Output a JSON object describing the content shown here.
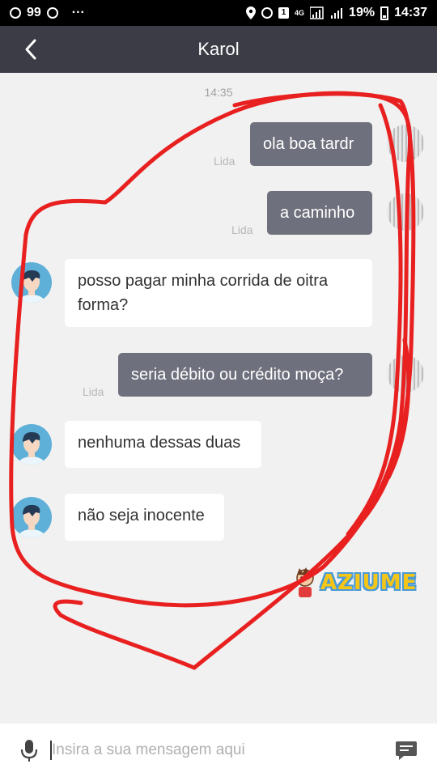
{
  "status_bar": {
    "left_count": "99",
    "dots": "···",
    "network": "4G",
    "battery": "19%",
    "time": "14:37"
  },
  "header": {
    "title": "Karol"
  },
  "chat": {
    "timestamp": "14:35",
    "messages": [
      {
        "direction": "out",
        "text": "ola boa tardr",
        "status": "Lida"
      },
      {
        "direction": "out",
        "text": "a caminho",
        "status": "Lida"
      },
      {
        "direction": "in",
        "text": "posso pagar minha corrida de oitra forma?"
      },
      {
        "direction": "out",
        "text": "seria débito ou crédito moça?",
        "status": "Lida"
      },
      {
        "direction": "in",
        "text": "nenhuma dessas duas"
      },
      {
        "direction": "in",
        "text": "não seja inocente"
      }
    ]
  },
  "watermark": {
    "text": "AZIUME"
  },
  "input": {
    "placeholder": "Insira a sua mensagem aqui"
  },
  "colors": {
    "header_bg": "#3b3c46",
    "outgoing_bubble": "#6f707d",
    "incoming_bubble": "#ffffff",
    "annotation": "#e82020"
  }
}
